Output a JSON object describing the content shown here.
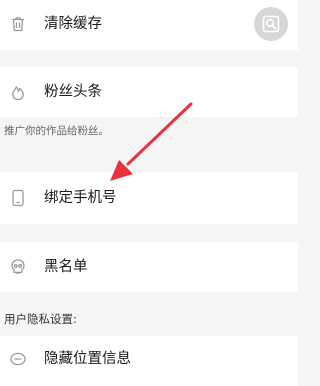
{
  "settings": {
    "items": [
      {
        "label": "清除缓存",
        "icon": "trash-icon"
      },
      {
        "label": "粉丝头条",
        "icon": "flame-icon"
      },
      {
        "label": "绑定手机号",
        "icon": "phone-icon"
      },
      {
        "label": "黑名单",
        "icon": "skull-icon"
      },
      {
        "label": "隐藏位置信息",
        "icon": "location-hide-icon"
      }
    ],
    "fans_hint": "推广你的作品给粉丝。",
    "privacy_header": "用户隐私设置:"
  },
  "floating_button": {
    "icon": "image-search-icon"
  },
  "annotation": {
    "color": "#e8333a",
    "target": "绑定手机号"
  },
  "colors": {
    "background": "#f5f5f5",
    "row": "#ffffff",
    "icon": "#9a9a9a",
    "text": "#1a1a1a",
    "hint": "#666666"
  }
}
